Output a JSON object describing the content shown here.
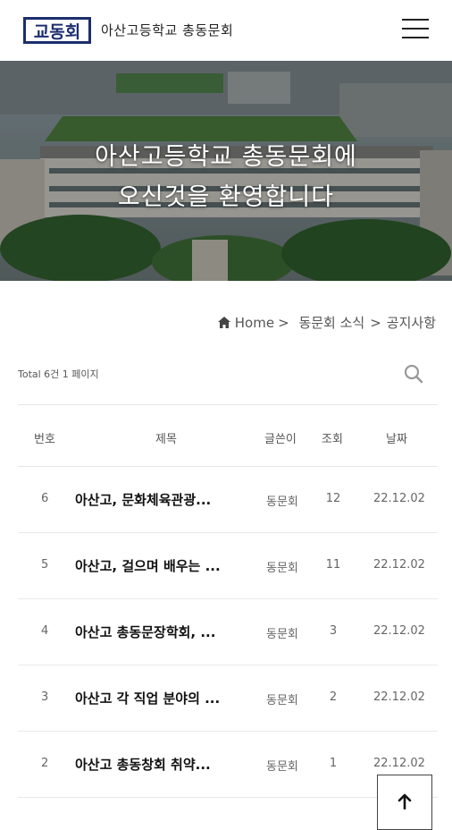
{
  "header": {
    "logo_text": "교동회",
    "title": "아산고등학교 총동문회",
    "menu_icon": "hamburger-menu-icon"
  },
  "hero": {
    "line1": "아산고등학교 총동문회에",
    "line2": "오신것을 환영합니다"
  },
  "breadcrumb": {
    "home": "Home",
    "sep": ">",
    "section": "동문회 소식",
    "page": "공지사항"
  },
  "list_info": {
    "total": "Total 6건 1 페이지"
  },
  "table": {
    "headers": [
      "번호",
      "제목",
      "글쓴이",
      "조회",
      "날짜"
    ],
    "rows": [
      {
        "no": "6",
        "title": "아산고, 문화체육관광...",
        "writer": "동문회",
        "views": "12",
        "date": "22.12.02"
      },
      {
        "no": "5",
        "title": "아산고, 걸으며 배우는 ...",
        "writer": "동문회",
        "views": "11",
        "date": "22.12.02"
      },
      {
        "no": "4",
        "title": "아산고 총동문장학회, ...",
        "writer": "동문회",
        "views": "3",
        "date": "22.12.02"
      },
      {
        "no": "3",
        "title": "아산고 각 직업 분야의 ...",
        "writer": "동문회",
        "views": "2",
        "date": "22.12.02"
      },
      {
        "no": "2",
        "title": "아산고 총동창회 취약...",
        "writer": "동문회",
        "views": "1",
        "date": "22.12.02"
      }
    ]
  },
  "colors": {
    "logo_navy": "#1c2e6e",
    "text": "#222222"
  }
}
